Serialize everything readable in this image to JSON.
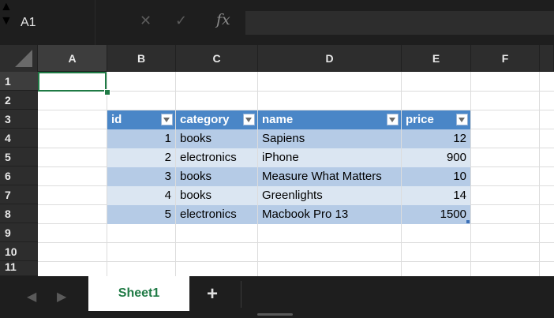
{
  "formula_bar": {
    "name_box": "A1",
    "stepper_icon": "stepper-arrows",
    "cancel_symbol": "✕",
    "confirm_symbol": "✓",
    "fx_label": "fx",
    "formula_value": ""
  },
  "columns": [
    "A",
    "B",
    "C",
    "D",
    "E",
    "F"
  ],
  "rows": [
    "1",
    "2",
    "3",
    "4",
    "5",
    "6",
    "7",
    "8",
    "9",
    "10",
    "11"
  ],
  "table": {
    "headers": [
      "id",
      "category",
      "name",
      "price"
    ],
    "records": [
      {
        "id": "1",
        "category": "books",
        "name": "Sapiens",
        "price": "12"
      },
      {
        "id": "2",
        "category": "electronics",
        "name": "iPhone",
        "price": "900"
      },
      {
        "id": "3",
        "category": "books",
        "name": "Measure What Matters",
        "price": "10"
      },
      {
        "id": "4",
        "category": "books",
        "name": "Greenlights",
        "price": "14"
      },
      {
        "id": "5",
        "category": "electronics",
        "name": "Macbook Pro 13",
        "price": "1500"
      }
    ]
  },
  "sheet_tabs": {
    "active": "Sheet1",
    "add_label": "+"
  },
  "colors": {
    "accent": "#1f7a45",
    "table_header": "#4a86c7",
    "band_dark": "#b5cbe6",
    "band_light": "#dbe6f2"
  }
}
